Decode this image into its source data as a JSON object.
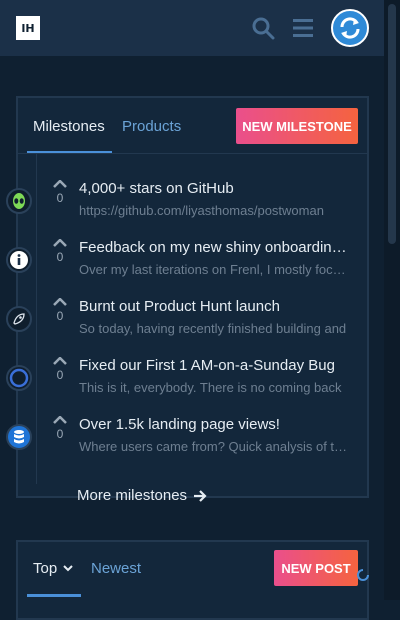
{
  "header": {
    "logo_text": "IH",
    "icons": [
      "search-icon",
      "hamburger-menu-icon",
      "sync-icon"
    ],
    "colors": {
      "background": "#1b3048",
      "accent": "#4a90d9"
    }
  },
  "milestones_card": {
    "tabs": [
      {
        "label": "Milestones",
        "active": true
      },
      {
        "label": "Products",
        "active": false
      }
    ],
    "new_button": "NEW MILESTONE",
    "items": [
      {
        "icon": "alien-icon",
        "votes": "0",
        "title": "4,000+ stars on GitHub",
        "desc": "https://github.com/liyasthomas/postwoman"
      },
      {
        "icon": "info-icon",
        "votes": "0",
        "title": "Feedback on my new shiny onboarding flow",
        "desc": "Over my last iterations on Frenl, I mostly focused"
      },
      {
        "icon": "rocket-icon",
        "votes": "0",
        "title": "Burnt out Product Hunt launch",
        "desc": "So today, having recently finished building and"
      },
      {
        "icon": "ring-icon",
        "votes": "0",
        "title": "Fixed our First 1 AM-on-a-Sunday Bug",
        "desc": "This is it, everybody. There is no coming back"
      },
      {
        "icon": "database-icon",
        "votes": "0",
        "title": "Over 1.5k landing page views!",
        "desc": "Where users came from? Quick analysis of traffic"
      }
    ],
    "more_link": "More milestones"
  },
  "posts_card": {
    "tabs": [
      {
        "label": "Top",
        "active": true
      },
      {
        "label": "Newest",
        "active": false
      }
    ],
    "new_button": "NEW POST"
  },
  "colors": {
    "button_gradient": [
      "#ea4f8c",
      "#f5633f"
    ],
    "card_bg": "#13273b",
    "page_bg": "#0f2031"
  }
}
